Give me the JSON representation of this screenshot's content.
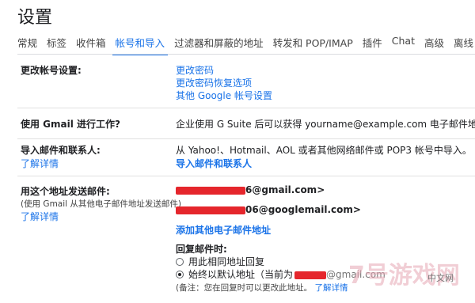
{
  "page": {
    "title": "设置"
  },
  "tabs": [
    {
      "label": "常规"
    },
    {
      "label": "标签"
    },
    {
      "label": "收件箱"
    },
    {
      "label": "帐号和导入",
      "active": true
    },
    {
      "label": "过滤器和屏蔽的地址"
    },
    {
      "label": "转发和 POP/IMAP"
    },
    {
      "label": "插件"
    },
    {
      "label": "Chat"
    },
    {
      "label": "高级"
    },
    {
      "label": "离线"
    }
  ],
  "sections": {
    "change_account": {
      "label": "更改帐号设置:",
      "links": [
        "更改密码",
        "更改密码恢复选项",
        "其他 Google 帐号设置"
      ]
    },
    "work": {
      "label": "使用 Gmail 进行工作?",
      "text": "企业使用 G Suite 后可以获得 yourname@example.com 电子邮件地址、"
    },
    "import": {
      "label": "导入邮件和联系人:",
      "learn_more": "了解详情",
      "text": "从 Yahoo!、Hotmail、AOL 或者其他网络邮件或 POP3 帐号中导入。",
      "action": "导入邮件和联系人"
    },
    "send_as": {
      "label": "用这个地址发送邮件:",
      "sublabel": "(使用 Gmail 从其他电子邮件地址发送邮件)",
      "learn_more": "了解详情",
      "emails": [
        "6@gmail.com>",
        "06@googlemail.com>"
      ],
      "add_link": "添加其他电子邮件地址",
      "reply_heading": "回复邮件时:",
      "reply_option_same": "用此相同地址回复",
      "reply_option_default": "始终以默认地址（当前为",
      "reply_option_default_tail": "@gmail.com",
      "note": "(备注：您在回复时可以更改此地址。",
      "note_link": "了解详情"
    }
  },
  "watermark": {
    "text": "7号游戏网",
    "sub": "中文网"
  },
  "colors": {
    "accent": "#1a73e8",
    "redaction": "#e5262c"
  }
}
